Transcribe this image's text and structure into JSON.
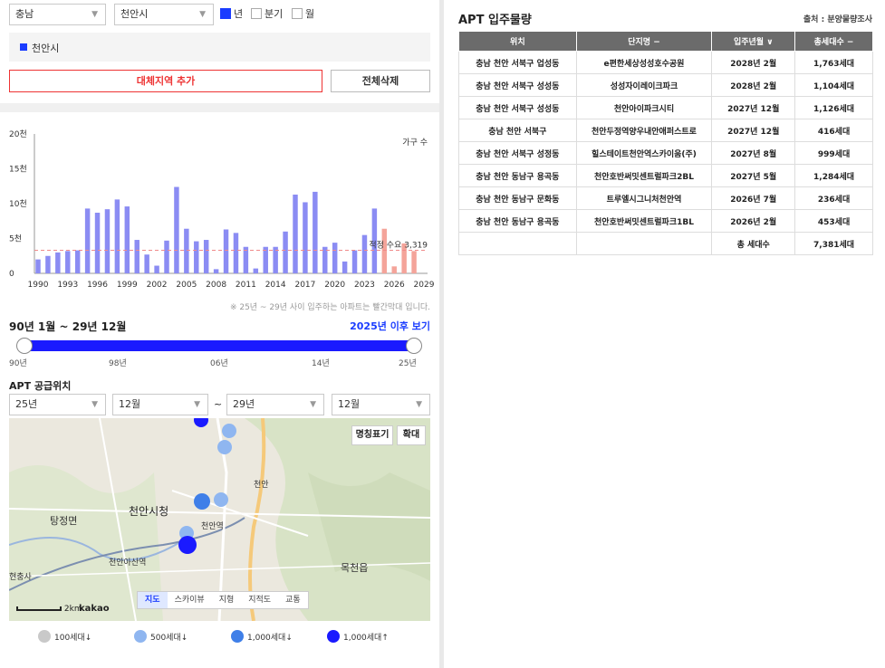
{
  "filters": {
    "province": "충남",
    "city": "천안시",
    "period_options": [
      {
        "label": "년",
        "checked": true
      },
      {
        "label": "분기",
        "checked": false
      },
      {
        "label": "월",
        "checked": false
      }
    ]
  },
  "selected_region": "천안시",
  "buttons": {
    "add_region": "대체지역 추가",
    "delete_all": "전체삭제"
  },
  "chart_data": {
    "type": "bar",
    "series_label": "가구 수",
    "y_ticks": [
      "20천",
      "15천",
      "10천",
      "5천",
      "0"
    ],
    "ylim": [
      0,
      20000
    ],
    "x_ticks": [
      "1990",
      "1993",
      "1996",
      "1999",
      "2002",
      "2005",
      "2008",
      "2011",
      "2014",
      "2017",
      "2020",
      "2023",
      "2026",
      "2029"
    ],
    "x": [
      1990,
      1991,
      1992,
      1993,
      1994,
      1995,
      1996,
      1997,
      1998,
      1999,
      2000,
      2001,
      2002,
      2003,
      2004,
      2005,
      2006,
      2007,
      2008,
      2009,
      2010,
      2011,
      2012,
      2013,
      2014,
      2015,
      2016,
      2017,
      2018,
      2019,
      2020,
      2021,
      2022,
      2023,
      2024,
      2025,
      2026,
      2027,
      2028,
      2029
    ],
    "values": [
      2000,
      2500,
      3000,
      3200,
      3300,
      9300,
      8700,
      9200,
      10600,
      9600,
      4800,
      2700,
      1100,
      4700,
      12400,
      6400,
      4600,
      4800,
      600,
      6300,
      5800,
      3800,
      700,
      3800,
      3800,
      6000,
      11300,
      10200,
      11700,
      3800,
      4400,
      1700,
      3300,
      5500,
      9300,
      6400,
      1000,
      4300,
      3200,
      0
    ],
    "series_colors": {
      "past": "#8b8cf3",
      "future": "#f4a49a"
    },
    "future_from": 2025,
    "threshold": 3319,
    "threshold_label": "적정 수요 3,319"
  },
  "chart_note": "※ 25년 ~ 29년 사이 입주하는 아파트는 빨간막대 입니다.",
  "range": {
    "title": "90년 1월 ~ 29년 12월",
    "link": "2025년 이후 보기",
    "ticks": [
      "90년",
      "98년",
      "06년",
      "14년",
      "25년"
    ]
  },
  "supply": {
    "title": "APT 공급위치",
    "from_year": "25년",
    "from_month": "12월",
    "tilde": "~",
    "to_year": "29년",
    "to_month": "12월"
  },
  "map": {
    "btn_label": "명칭표기",
    "btn_zoom": "확대",
    "places": [
      "천안시청",
      "탕정면",
      "천안역",
      "천안아산역",
      "목천읍",
      "현충사",
      "천안"
    ],
    "tabs": [
      "지도",
      "스카이뷰",
      "지형",
      "지적도",
      "교통"
    ],
    "scale": "2km",
    "brand": "kakao"
  },
  "legend": [
    {
      "label": "100세대↓",
      "color": "#c9c9c9"
    },
    {
      "label": "500세대↓",
      "color": "#8fb6f0"
    },
    {
      "label": "1,000세대↓",
      "color": "#3f7fe8"
    },
    {
      "label": "1,000세대↑",
      "color": "#1a1aff"
    }
  ],
  "right": {
    "title": "APT 입주물량",
    "source": "출처 : 분양물량조사",
    "columns": [
      "위치",
      "단지명 −",
      "입주년월 ∨",
      "총세대수 −"
    ],
    "rows": [
      [
        "충남 천안 서북구 업성동",
        "e편한세상성성호수공원",
        "2028년 2월",
        "1,763세대"
      ],
      [
        "충남 천안 서북구 성성동",
        "성성자이레이크파크",
        "2028년 2월",
        "1,104세대"
      ],
      [
        "충남 천안 서북구 성성동",
        "천안아이파크시티",
        "2027년 12월",
        "1,126세대"
      ],
      [
        "충남 천안 서북구",
        "천안두정역양우내안애퍼스트로",
        "2027년 12월",
        "416세대"
      ],
      [
        "충남 천안 서북구 성정동",
        "힐스테이트천안역스카이움(주)",
        "2027년 8월",
        "999세대"
      ],
      [
        "충남 천안 동남구 용곡동",
        "천안호반써밋센트럴파크2BL",
        "2027년 5월",
        "1,284세대"
      ],
      [
        "충남 천안 동남구 문화동",
        "트루엘시그니처천안역",
        "2026년 7월",
        "236세대"
      ],
      [
        "충남 천안 동남구 용곡동",
        "천안호반써밋센트럴파크1BL",
        "2026년 2월",
        "453세대"
      ]
    ],
    "total_label": "총 세대수",
    "total_value": "7,381세대"
  }
}
